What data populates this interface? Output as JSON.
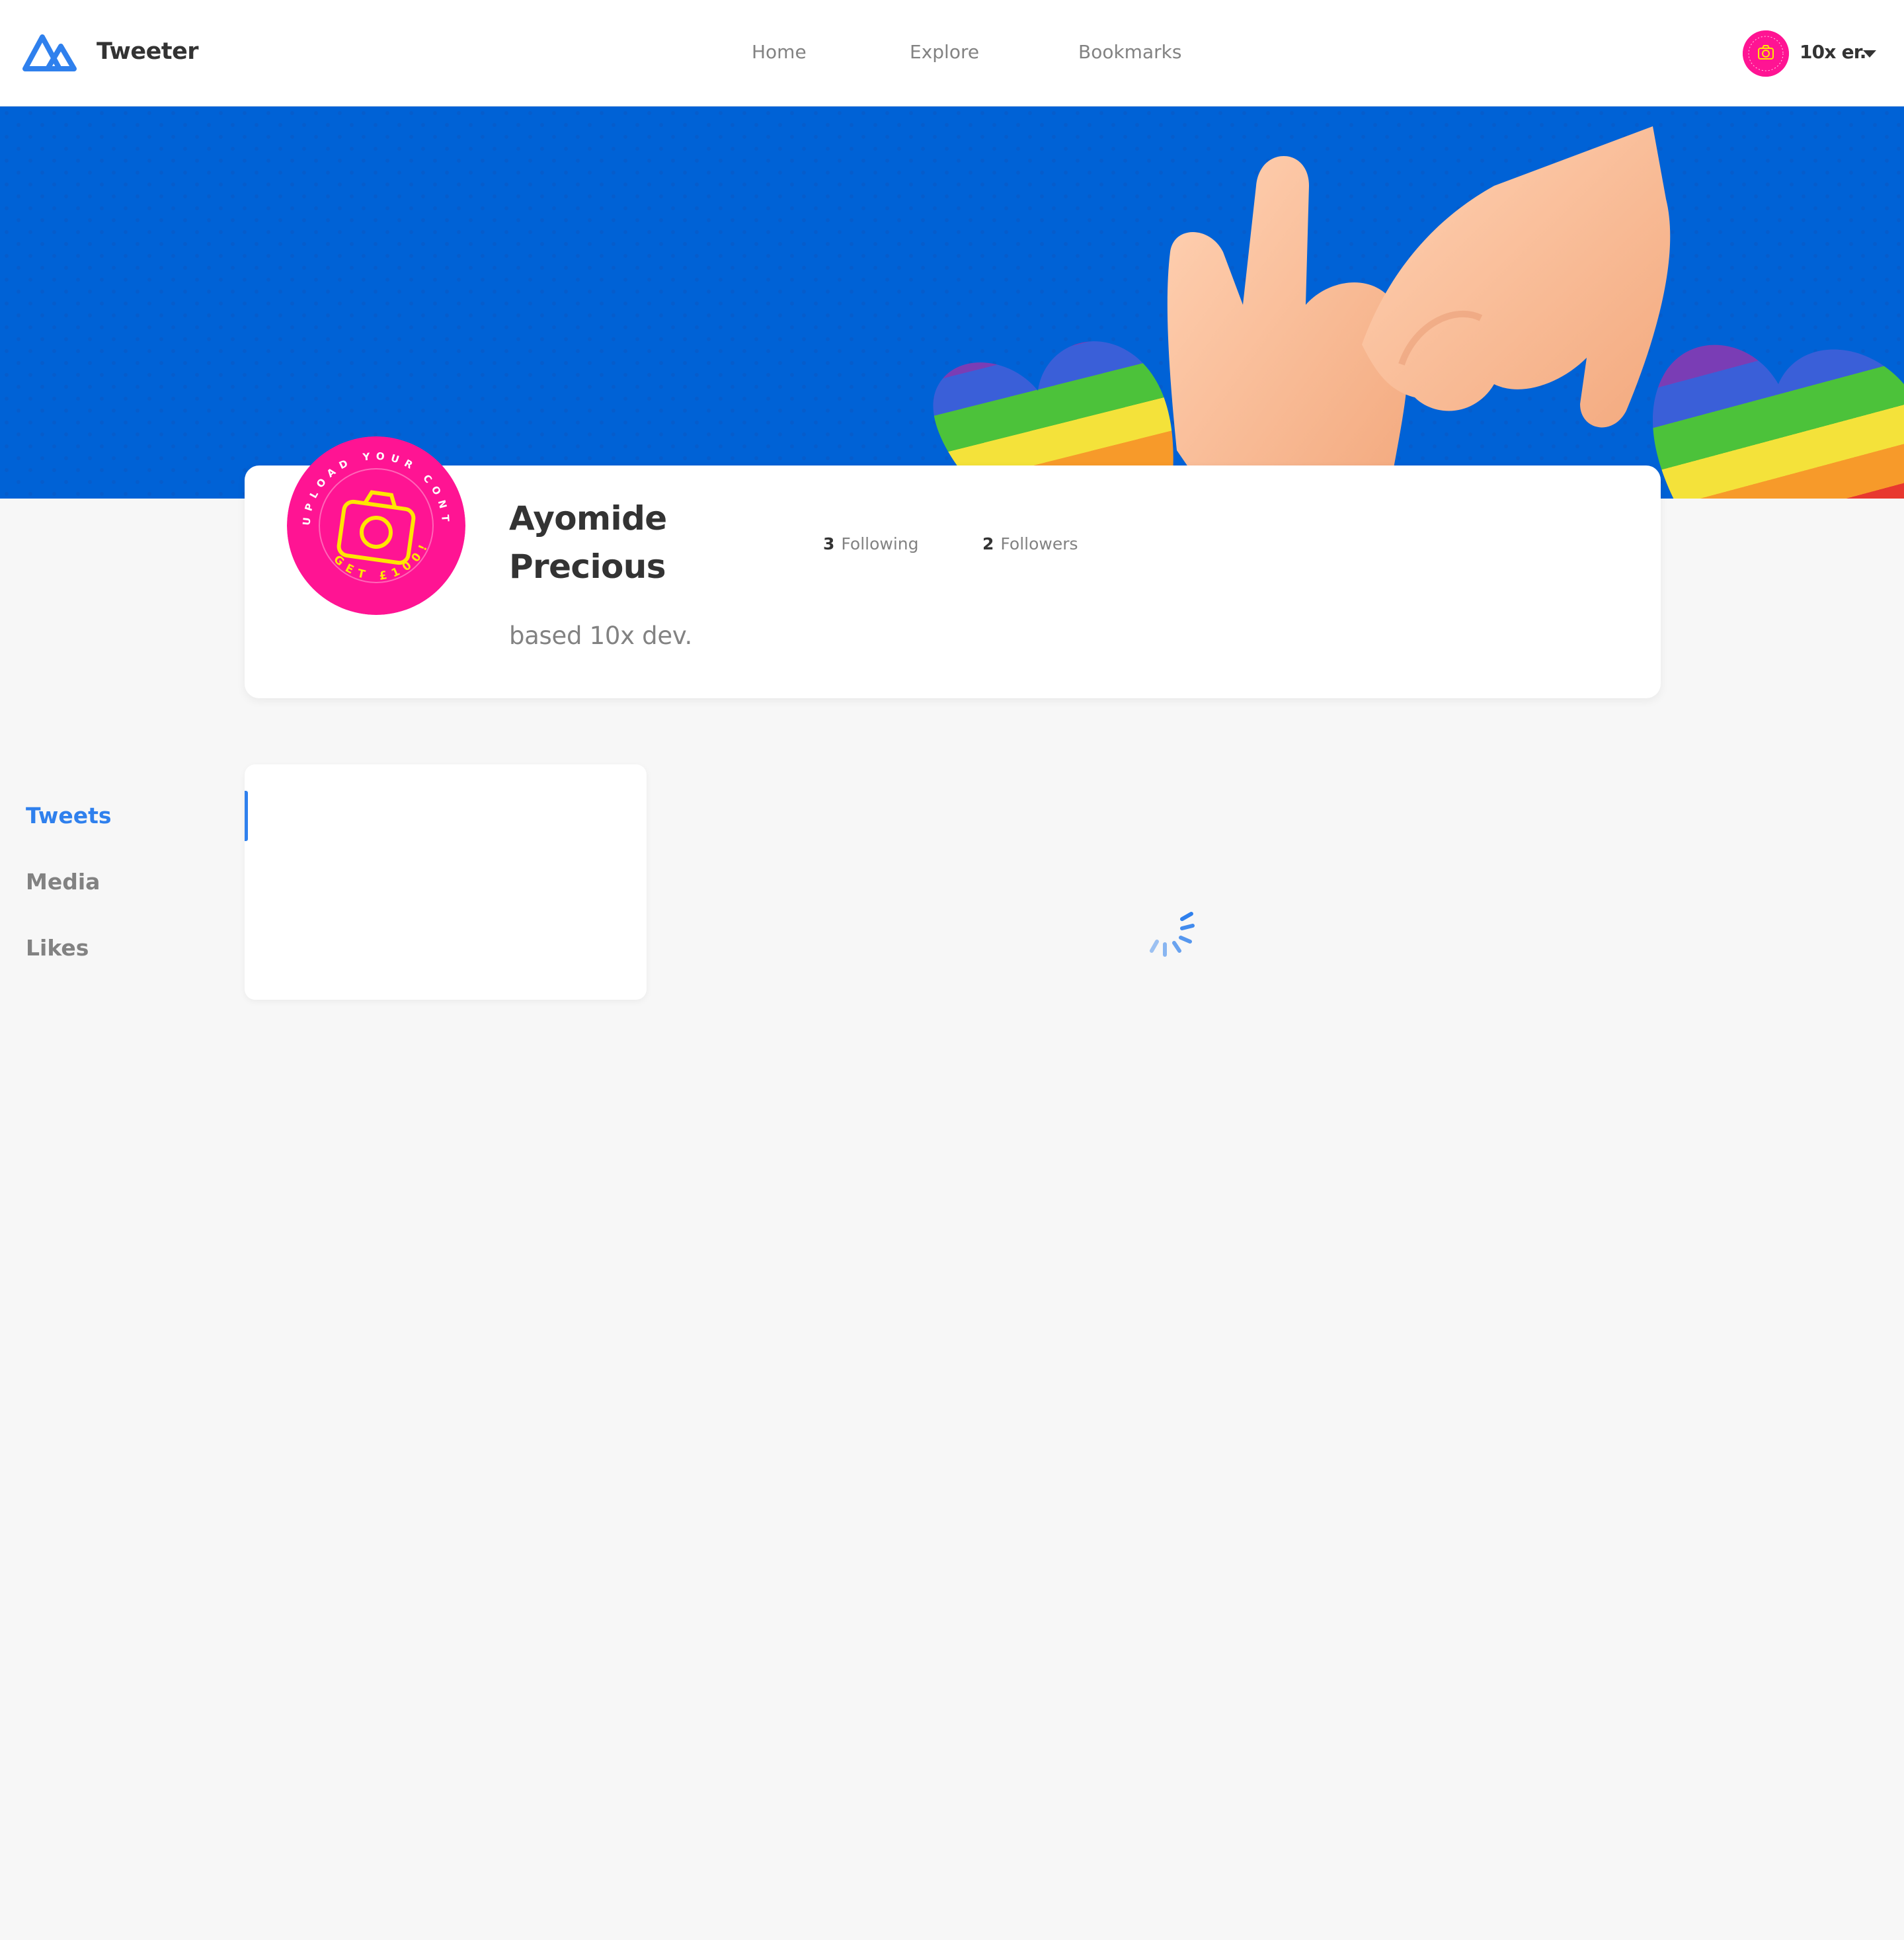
{
  "header": {
    "brand": "Tweeter",
    "logo_icon": "tweeter-logo-icon",
    "nav": [
      {
        "label": "Home"
      },
      {
        "label": "Explore"
      },
      {
        "label": "Bookmarks"
      }
    ],
    "user": {
      "name": "10x er.",
      "avatar_icon": "camera-icon",
      "menu_icon": "caret-down-icon"
    }
  },
  "profile": {
    "name": "Ayomide Precious",
    "bio": "based 10x dev.",
    "following_count": "3",
    "following_label": "Following",
    "followers_count": "2",
    "followers_label": "Followers",
    "avatar_badge_text_top": "UPLOAD YOUR CONTENT",
    "avatar_badge_text_bottom": "GET £100!"
  },
  "tabs": [
    {
      "label": "Tweets",
      "active": true
    },
    {
      "label": "Media",
      "active": false
    },
    {
      "label": "Likes",
      "active": false
    }
  ],
  "feed": {
    "loading": true
  },
  "colors": {
    "accent": "#2f80ed",
    "cover_blue": "#0062d6",
    "avatar_pink": "#ff1493",
    "badge_yellow": "#ffe600",
    "background": "#f7f7f7"
  }
}
